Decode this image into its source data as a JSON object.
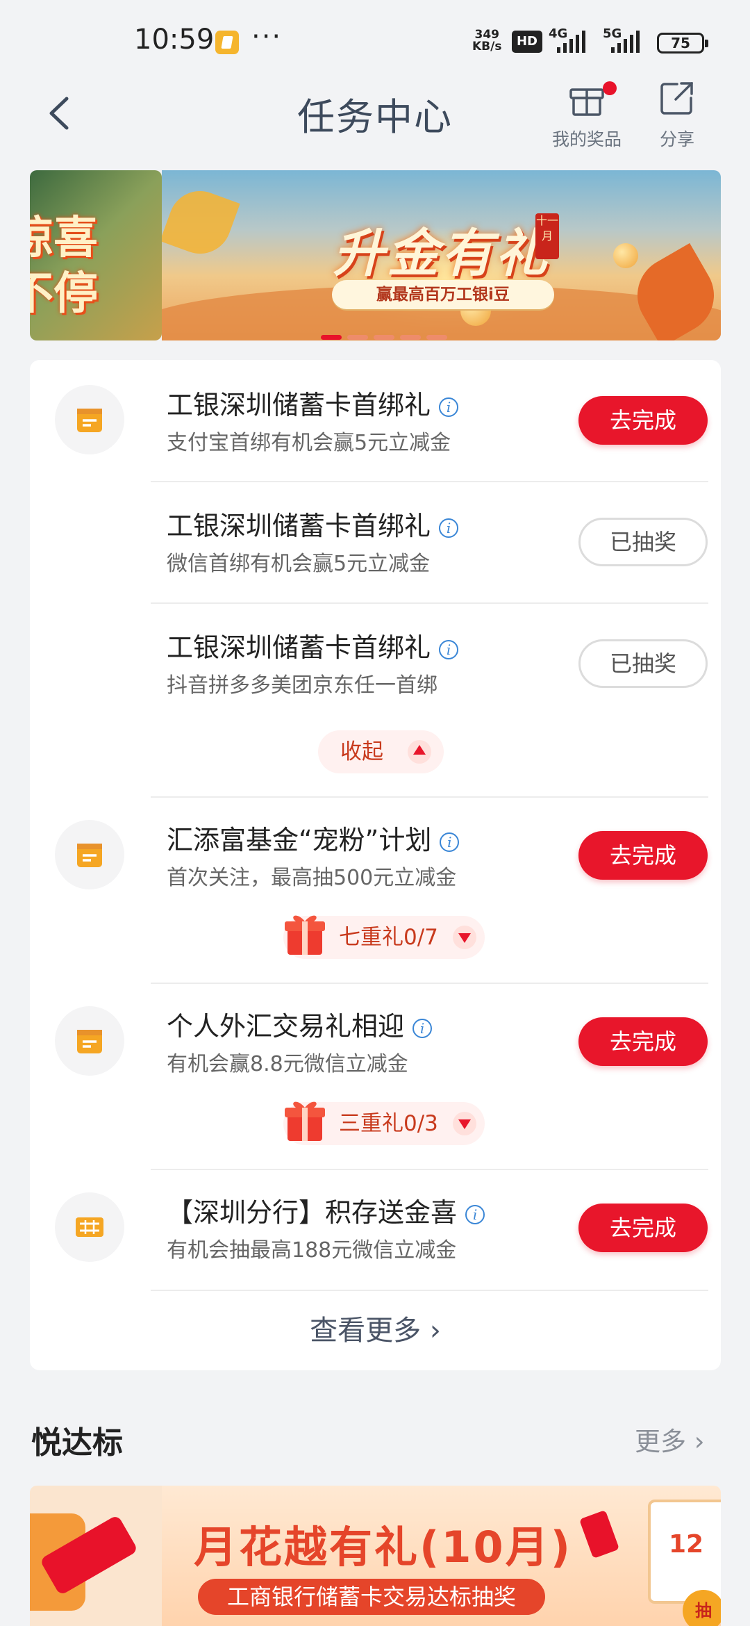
{
  "status_bar": {
    "time": "10:59",
    "net_speed_value": "349",
    "net_speed_unit": "KB/s",
    "hd_label": "HD",
    "net1": "4G",
    "net2": "5G",
    "battery": "75"
  },
  "header": {
    "title": "任务中心",
    "my_prizes": "我的奖品",
    "share": "分享"
  },
  "banner": {
    "left_text_1": "惊喜",
    "left_text_2": "不停",
    "title": "升金有礼",
    "badge": "十一月",
    "subtitle": "赢最高百万工银i豆",
    "active_dot": 1,
    "dot_count": 5
  },
  "tasks": [
    {
      "title": "工银深圳储蓄卡首绑礼",
      "subtitle": "支付宝首绑有机会赢5元立减金",
      "action": "去完成"
    },
    {
      "title": "工银深圳储蓄卡首绑礼",
      "subtitle": "微信首绑有机会赢5元立减金",
      "action": "已抽奖"
    },
    {
      "title": "工银深圳储蓄卡首绑礼",
      "subtitle": "抖音拼多多美团京东任一首绑",
      "action": "已抽奖"
    },
    {
      "title": "汇添富基金“宠粉”计划",
      "subtitle": "首次关注，最高抽500元立减金",
      "action": "去完成",
      "reward": "七重礼0/7"
    },
    {
      "title": "个人外汇交易礼相迎",
      "subtitle": "有机会赢8.8元微信立减金",
      "action": "去完成",
      "reward": "三重礼0/3"
    },
    {
      "title": "【深圳分行】积存送金喜",
      "subtitle": "有机会抽最高188元微信立减金",
      "action": "去完成"
    }
  ],
  "collapse_label": "收起",
  "see_more": "查看更多",
  "section": {
    "title": "悦达标",
    "more": "更多"
  },
  "bottom_banner": {
    "title": "月花越有礼(10月)",
    "subtitle": "工商银行储蓄卡交易达标抽奖",
    "calendar": "12",
    "coin": "抽"
  },
  "colors": {
    "accent_red": "#e8162b",
    "title_gray": "#3d4a5c"
  }
}
